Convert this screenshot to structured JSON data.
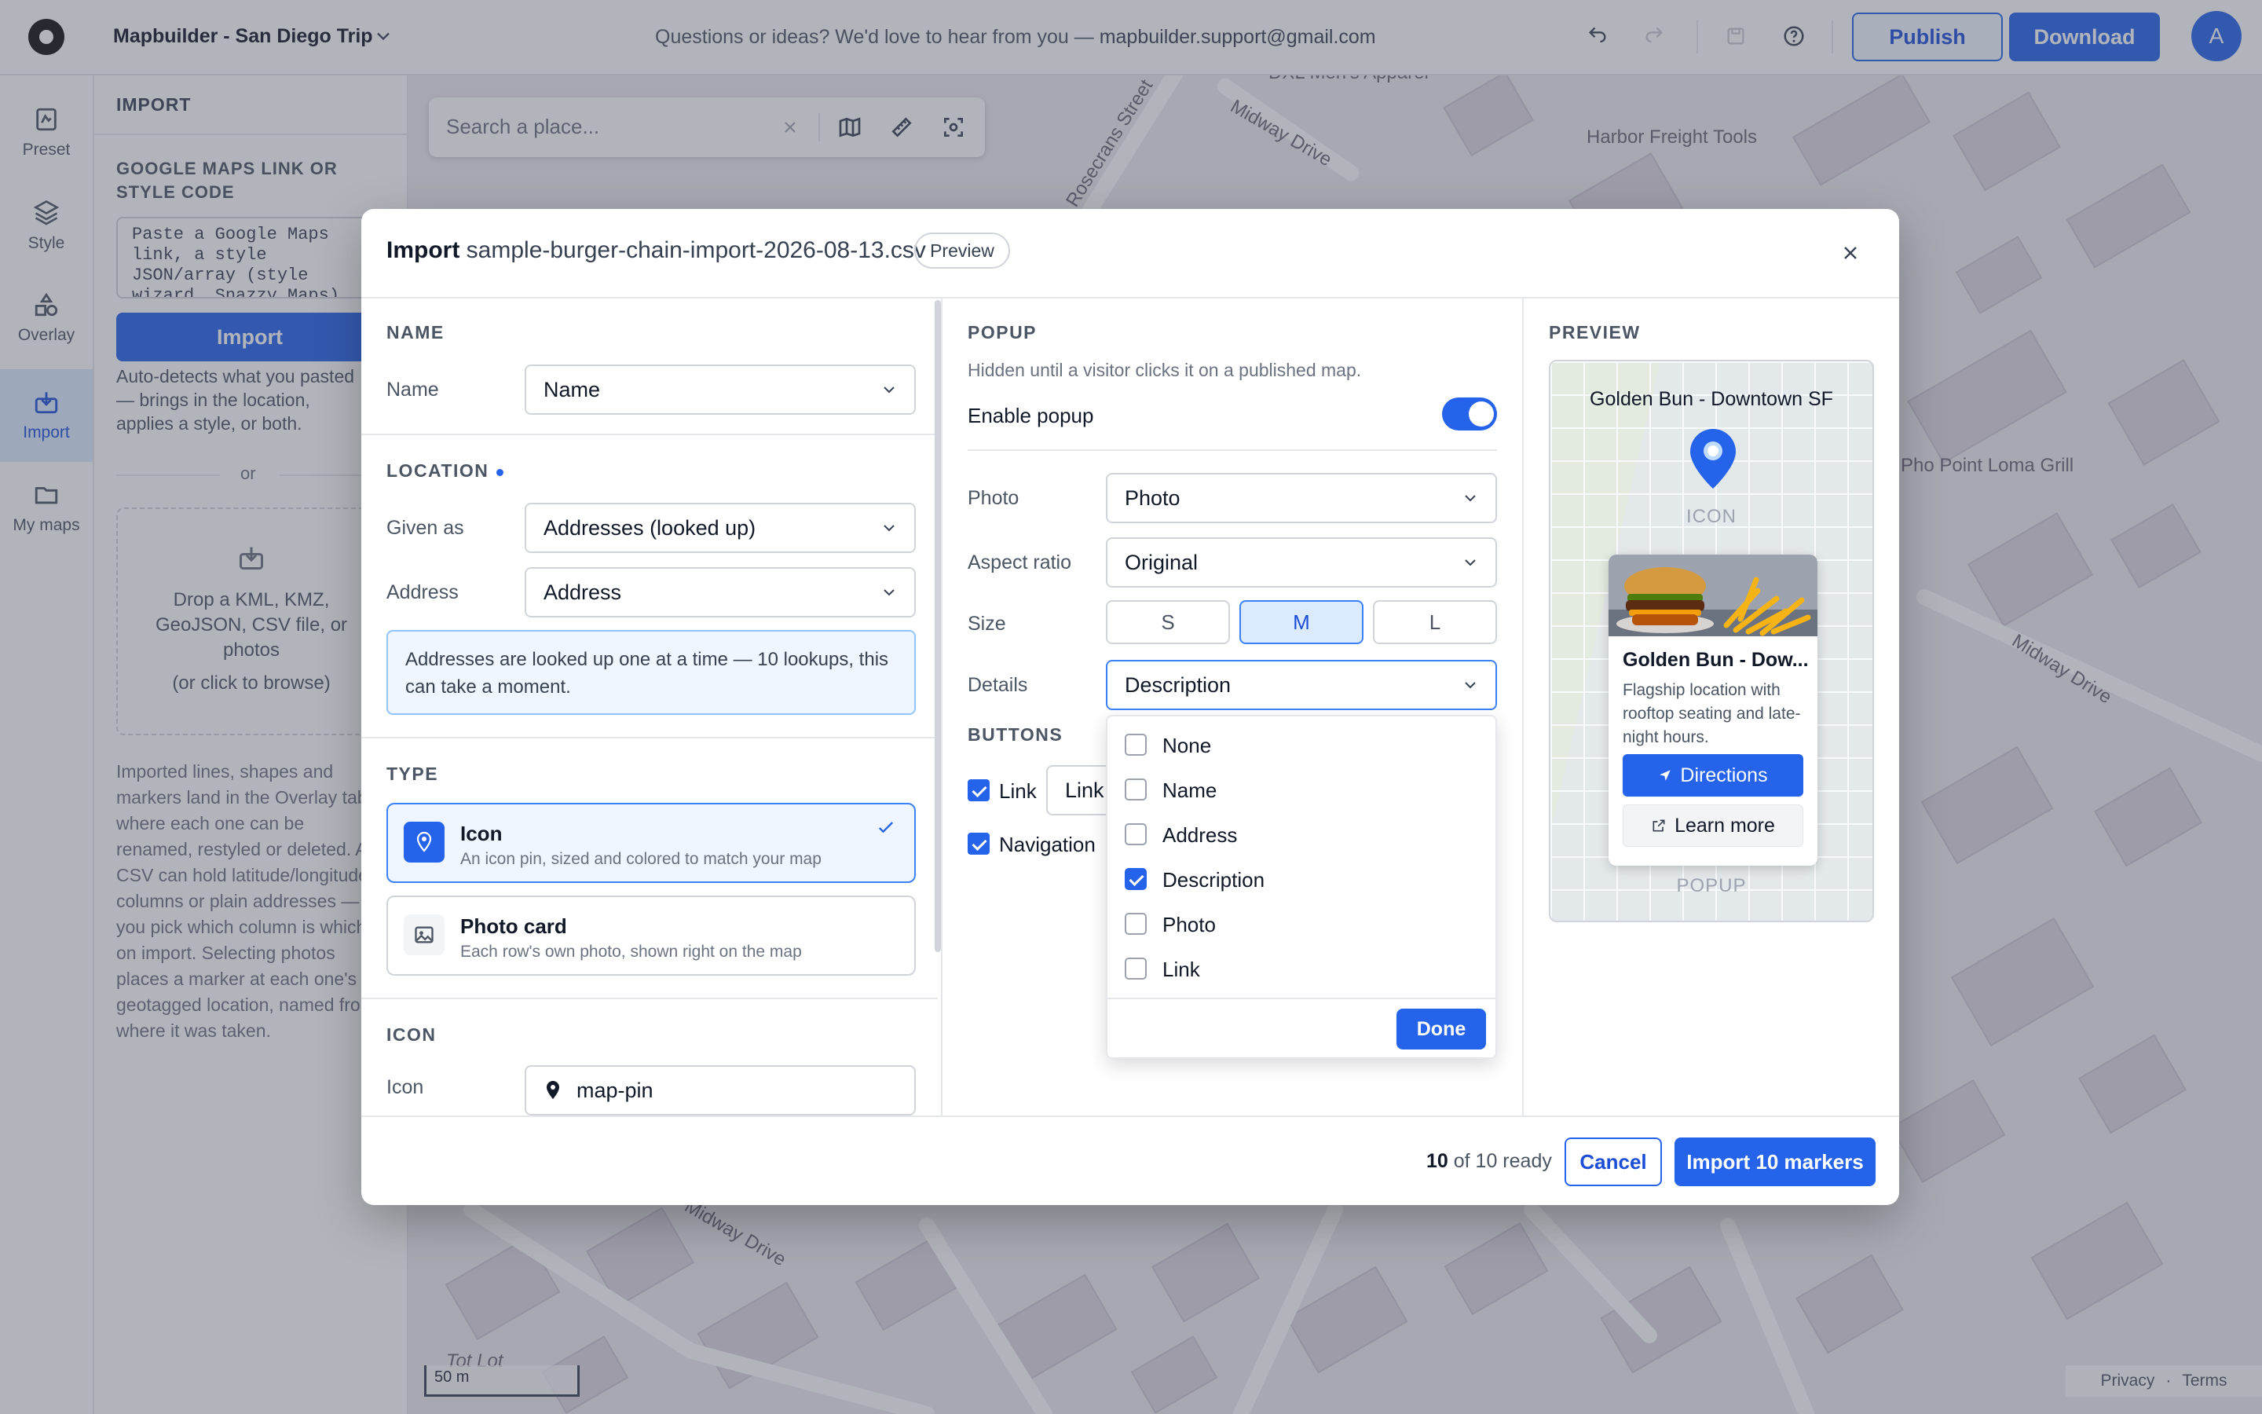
{
  "app": {
    "title": "Mapbuilder - San Diego Trip",
    "feedback_text": "Questions or ideas? We'd love to hear from you — ",
    "feedback_email": "mapbuilder.support@gmail.com",
    "publish_label": "Publish",
    "download_label": "Download",
    "avatar_initial": "A",
    "accent": "#2563eb"
  },
  "rail": {
    "items": [
      {
        "label": "Preset",
        "icon": "preset-icon"
      },
      {
        "label": "Style",
        "icon": "layers-icon"
      },
      {
        "label": "Overlay",
        "icon": "shapes-icon"
      },
      {
        "label": "Import",
        "icon": "import-icon"
      },
      {
        "label": "My maps",
        "icon": "folder-icon"
      }
    ],
    "active": "Import"
  },
  "left_panel": {
    "title": "IMPORT",
    "link_section_title": "GOOGLE MAPS LINK OR STYLE CODE",
    "link_placeholder": "Paste a Google Maps link, a style JSON/array (style wizard, Snazzy Maps)",
    "import_button": "Import",
    "autodetect_text": "Auto-detects what you pasted — brings in the location, applies a style, or both.",
    "or_text": "or",
    "drop_text": "Drop a KML, KMZ, GeoJSON, CSV file, or photos",
    "browse_text": "(or click to browse)",
    "info_text": "Imported lines, shapes and markers land in the Overlay tab, where each one can be renamed, restyled or deleted. A CSV can hold latitude/longitude columns or plain addresses — you pick which column is which on import. Selecting photos places a marker at each one's geotagged location, named from where it was taken."
  },
  "map": {
    "search_placeholder": "Search a place...",
    "labels": [
      "Midway Drive",
      "Rosecrans Street",
      "Harbor Freight Tools",
      "Pho Point Loma Grill",
      "Midway Drive",
      "DXL Men's Apparel",
      "Midway Drive",
      "Tot Lot"
    ],
    "scale_label": "50 m",
    "privacy": "Privacy",
    "terms": "Terms"
  },
  "modal": {
    "title_bold": "Import",
    "filename": "sample-burger-chain-import-2026-08-13.csv",
    "preview_badge": "Preview",
    "name_section": "NAME",
    "name_label": "Name",
    "name_value": "Name",
    "location_section": "LOCATION",
    "given_as_label": "Given as",
    "given_as_value": "Addresses (looked up)",
    "address_label": "Address",
    "address_value": "Address",
    "lookup_notice": "Addresses are looked up one at a time — 10 lookups, this can take a moment.",
    "type_section": "TYPE",
    "type_options": [
      {
        "title": "Icon",
        "desc": "An icon pin, sized and colored to match your map",
        "selected": true
      },
      {
        "title": "Photo card",
        "desc": "Each row's own photo, shown right on the map",
        "selected": false
      }
    ],
    "icon_section": "ICON",
    "icon_label": "Icon",
    "icon_value": "map-pin",
    "popup_section": "POPUP",
    "popup_hint": "Hidden until a visitor clicks it on a published map.",
    "enable_popup_label": "Enable popup",
    "enable_popup": true,
    "photo_label": "Photo",
    "photo_value": "Photo",
    "aspect_label": "Aspect ratio",
    "aspect_value": "Original",
    "size_label": "Size",
    "sizes": [
      "S",
      "M",
      "L"
    ],
    "size_selected": "M",
    "details_label": "Details",
    "details_value": "Description",
    "buttons_section": "BUTTONS",
    "link_check_label": "Link",
    "link_select_value": "Link",
    "navigation_check_label": "Navigation",
    "details_options": [
      {
        "label": "None",
        "checked": false
      },
      {
        "label": "Name",
        "checked": false
      },
      {
        "label": "Address",
        "checked": false
      },
      {
        "label": "Description",
        "checked": true
      },
      {
        "label": "Photo",
        "checked": false
      },
      {
        "label": "Link",
        "checked": false
      }
    ],
    "done_label": "Done",
    "preview_section": "PREVIEW",
    "preview_title": "Golden Bun - Downtown SF",
    "icon_caption": "ICON",
    "popup_caption": "POPUP",
    "card_title": "Golden Bun - Dow...",
    "card_desc": "Flagship location with rooftop seating and late-night hours.",
    "directions_label": "Directions",
    "learn_more_label": "Learn more",
    "ready_count": "10",
    "ready_text": " of 10 ready",
    "cancel_label": "Cancel",
    "import_label": "Import 10 markers"
  }
}
